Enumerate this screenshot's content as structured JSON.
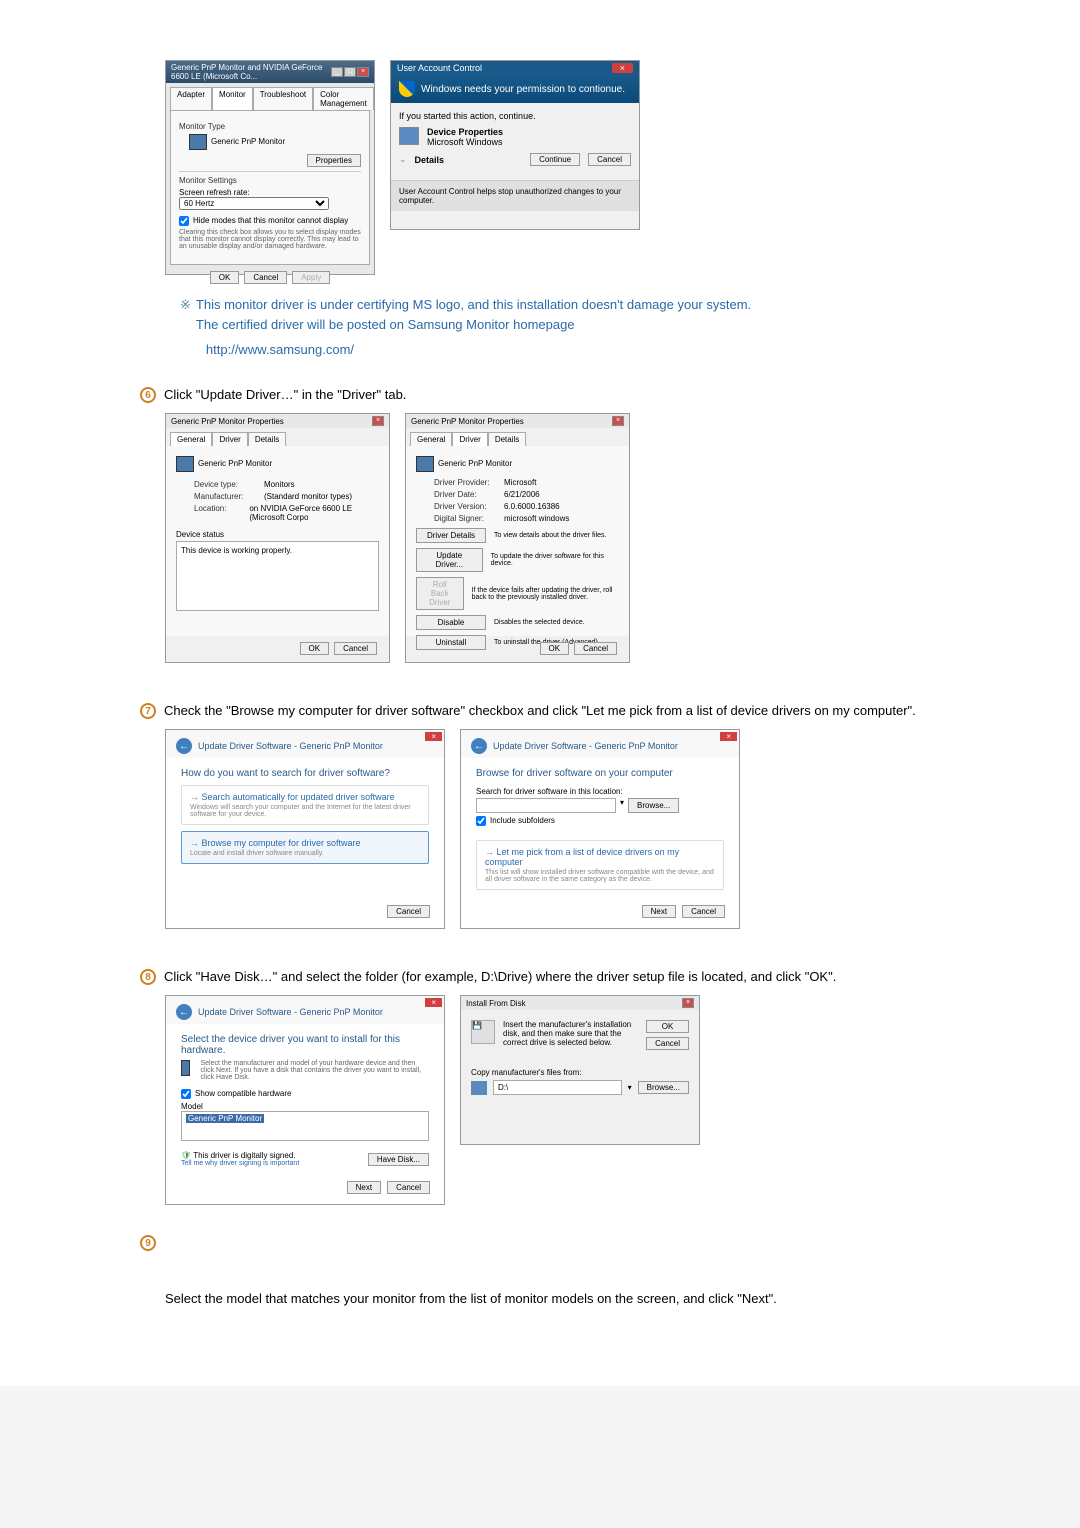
{
  "monitor_props": {
    "title": "Generic PnP Monitor and NVIDIA GeForce 6600 LE (Microsoft Co...",
    "tabs": [
      "Adapter",
      "Monitor",
      "Troubleshoot",
      "Color Management"
    ],
    "type_label": "Monitor Type",
    "type_value": "Generic PnP Monitor",
    "props_btn": "Properties",
    "settings_label": "Monitor Settings",
    "refresh_label": "Screen refresh rate:",
    "refresh_value": "60 Hertz",
    "hide_text": "Hide modes that this monitor cannot display",
    "hide_note": "Clearing this check box allows you to select display modes that this monitor cannot display correctly. This may lead to an unusable display and/or damaged hardware.",
    "ok": "OK",
    "cancel": "Cancel",
    "apply": "Apply"
  },
  "uac": {
    "title": "User Account Control",
    "headline": "Windows needs your permission to contionue.",
    "started": "If you started this action, continue.",
    "prop_title": "Device Properties",
    "prop_sub": "Microsoft Windows",
    "details": "Details",
    "continue": "Continue",
    "cancel": "Cancel",
    "footer": "User Account Control helps stop unauthorized changes to your computer."
  },
  "note": {
    "line1": "This monitor driver is under certifying MS logo, and this installation doesn't damage your system.",
    "line2": "The certified driver will be posted on Samsung Monitor homepage",
    "link": "http://www.samsung.com/"
  },
  "step6": {
    "num": "6",
    "text": "Click \"Update Driver…\" in the \"Driver\" tab."
  },
  "gen_props": {
    "title": "Generic PnP Monitor Properties",
    "tabs": [
      "General",
      "Driver",
      "Details"
    ],
    "name": "Generic PnP Monitor",
    "dev_type_l": "Device type:",
    "dev_type_v": "Monitors",
    "mfr_l": "Manufacturer:",
    "mfr_v": "(Standard monitor types)",
    "loc_l": "Location:",
    "loc_v": "on NVIDIA GeForce 6600 LE (Microsoft Corpo",
    "status_l": "Device status",
    "status_v": "This device is working properly.",
    "ok": "OK",
    "cancel": "Cancel"
  },
  "drv_props": {
    "title": "Generic PnP Monitor Properties",
    "tabs": [
      "General",
      "Driver",
      "Details"
    ],
    "name": "Generic PnP Monitor",
    "prov_l": "Driver Provider:",
    "prov_v": "Microsoft",
    "date_l": "Driver Date:",
    "date_v": "6/21/2006",
    "ver_l": "Driver Version:",
    "ver_v": "6.0.6000.16386",
    "sig_l": "Digital Signer:",
    "sig_v": "microsoft windows",
    "b1": "Driver Details",
    "b1d": "To view details about the driver files.",
    "b2": "Update Driver...",
    "b2d": "To update the driver software for this device.",
    "b3": "Roll Back Driver",
    "b3d": "If the device fails after updating the driver, roll back to the previously installed driver.",
    "b4": "Disable",
    "b4d": "Disables the selected device.",
    "b5": "Uninstall",
    "b5d": "To uninstall the driver (Advanced).",
    "ok": "OK",
    "cancel": "Cancel"
  },
  "step7": {
    "num": "7",
    "text": "Check the \"Browse my computer for driver software\" checkbox and click \"Let me pick from a list of device drivers on my computer\"."
  },
  "wiz1": {
    "crumb": "Update Driver Software - Generic PnP Monitor",
    "heading": "How do you want to search for driver software?",
    "opt1t": "Search automatically for updated driver software",
    "opt1s": "Windows will search your computer and the Internet for the latest driver software for your device.",
    "opt2t": "Browse my computer for driver software",
    "opt2s": "Locate and install driver software manually.",
    "cancel": "Cancel"
  },
  "wiz2": {
    "crumb": "Update Driver Software - Generic PnP Monitor",
    "heading": "Browse for driver software on your computer",
    "search_l": "Search for driver software in this location:",
    "browse": "Browse...",
    "include": "Include subfolders",
    "opt_t": "Let me pick from a list of device drivers on my computer",
    "opt_s": "This list will show installed driver software compatible with the device, and all driver software in the same category as the device.",
    "next": "Next",
    "cancel": "Cancel"
  },
  "step8": {
    "num": "8",
    "text": "Click \"Have Disk…\" and select the folder (for example, D:\\Drive) where the driver setup file is located, and click \"OK\"."
  },
  "wiz3": {
    "crumb": "Update Driver Software - Generic PnP Monitor",
    "heading": "Select the device driver you want to install for this hardware.",
    "sub": "Select the manufacturer and model of your hardware device and then click Next. If you have a disk that contains the driver you want to install, click Have Disk.",
    "compat": "Show compatible hardware",
    "model_l": "Model",
    "model_v": "Generic PnP Monitor",
    "signed": "This driver is digitally signed.",
    "tell": "Tell me why driver signing is important",
    "have_disk": "Have Disk...",
    "next": "Next",
    "cancel": "Cancel"
  },
  "disk": {
    "title": "Install From Disk",
    "msg": "Insert the manufacturer's installation disk, and then make sure that the correct drive is selected below.",
    "ok": "OK",
    "cancel": "Cancel",
    "copy": "Copy manufacturer's files from:",
    "path": "D:\\",
    "browse": "Browse..."
  },
  "step9": {
    "num": "9",
    "text": "Select the model that matches your monitor from the list of monitor models on the screen, and click \"Next\"."
  }
}
